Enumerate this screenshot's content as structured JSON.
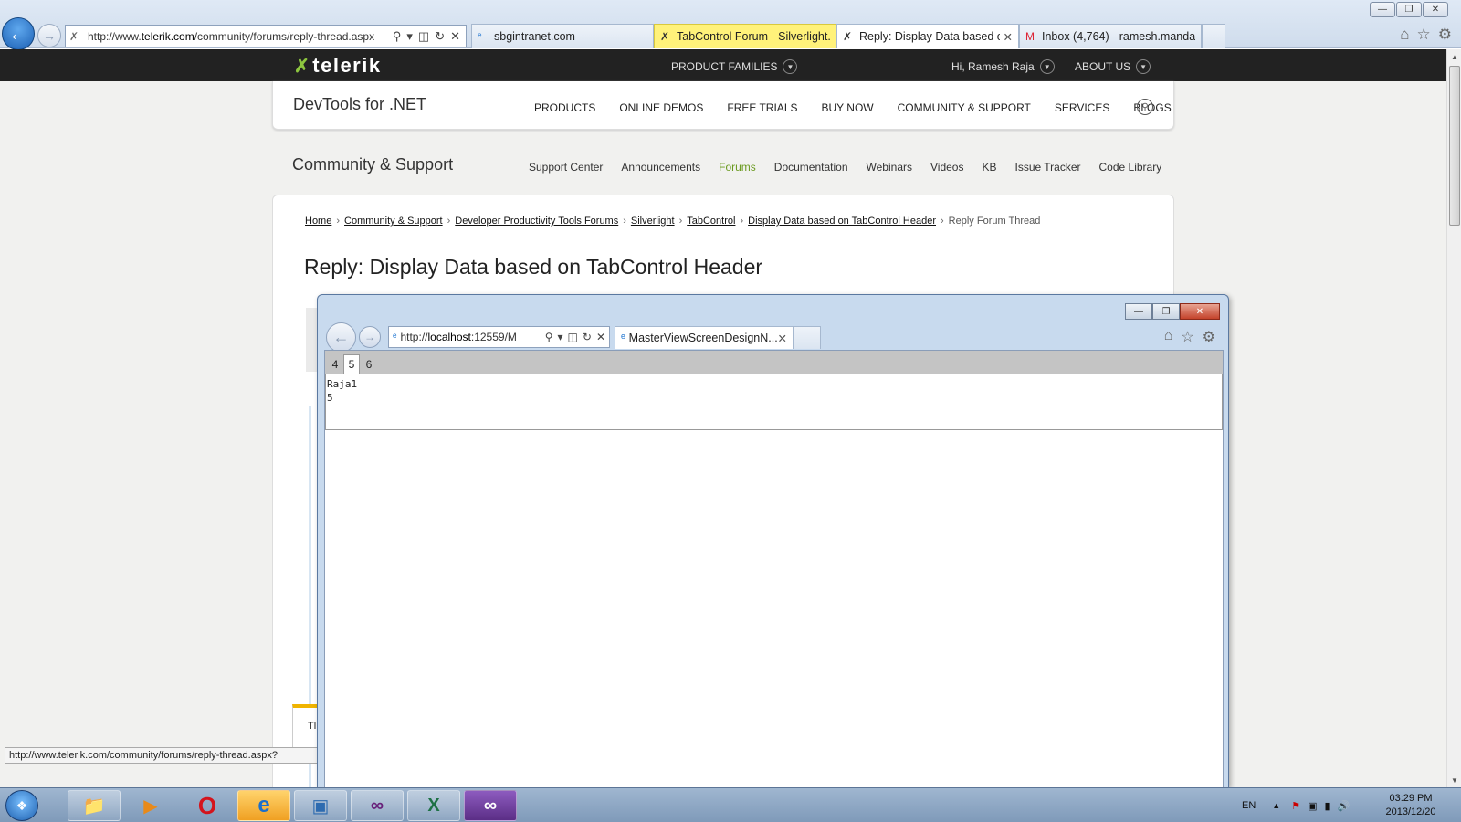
{
  "browser": {
    "address": {
      "prefix": "http://www.",
      "domain": "telerik.com",
      "path": "/community/forums/reply-thread.aspx"
    },
    "tabs": [
      {
        "label": "sbgintranet.com",
        "icon": "ie-icon"
      },
      {
        "label": "TabControl Forum - Silverlight...",
        "icon": "telerik-icon"
      },
      {
        "label": "Reply: Display Data based o...",
        "icon": "telerik-icon"
      },
      {
        "label": "Inbox (4,764) - ramesh.manda...",
        "icon": "gmail-icon"
      }
    ],
    "status_url": "http://www.telerik.com/community/forums/reply-thread.aspx?"
  },
  "site": {
    "logo": "telerik",
    "top_nav": {
      "product_families": "PRODUCT FAMILIES",
      "greeting": "Hi, Ramesh Raja",
      "about": "ABOUT US"
    },
    "section_title": "DevTools for .NET",
    "main_nav": [
      "PRODUCTS",
      "ONLINE DEMOS",
      "FREE TRIALS",
      "BUY NOW",
      "COMMUNITY & SUPPORT",
      "SERVICES",
      "BLOGS"
    ],
    "cs_title": "Community & Support",
    "sub_nav": [
      "Support Center",
      "Announcements",
      "Forums",
      "Documentation",
      "Webinars",
      "Videos",
      "KB",
      "Issue Tracker",
      "Code Library"
    ],
    "active_sub_nav": "Forums",
    "breadcrumb": [
      "Home",
      "Community & Support",
      "Developer Productivity Tools Forums",
      "Silverlight",
      "TabControl",
      "Display Data based on TabControl Header"
    ],
    "breadcrumb_current": "Reply Forum Thread",
    "page_title": "Reply: Display Data based on TabControl Header",
    "partial_box_text": "Tl"
  },
  "popup": {
    "address": {
      "prefix": "http://",
      "host": "localhost",
      "rest": ":12559/M"
    },
    "tab_label": "MasterViewScreenDesignN...",
    "tab_control": {
      "tabs": [
        "4",
        "5",
        "6"
      ],
      "selected": "5",
      "content_lines": [
        "Raja1",
        "5"
      ]
    }
  },
  "taskbar": {
    "apps": [
      "file-explorer-icon",
      "media-player-icon",
      "opera-icon",
      "internet-explorer-icon",
      "network-tool-icon",
      "visual-studio-icon",
      "excel-icon",
      "visual-studio-2-icon"
    ],
    "language": "EN",
    "time": "03:29 PM",
    "date": "2013/12/20"
  },
  "colors": {
    "accent_green": "#8dc63f",
    "active_link": "#6a9a1f",
    "topbar": "#222222",
    "active_tab_yellow": "#fff27a"
  }
}
